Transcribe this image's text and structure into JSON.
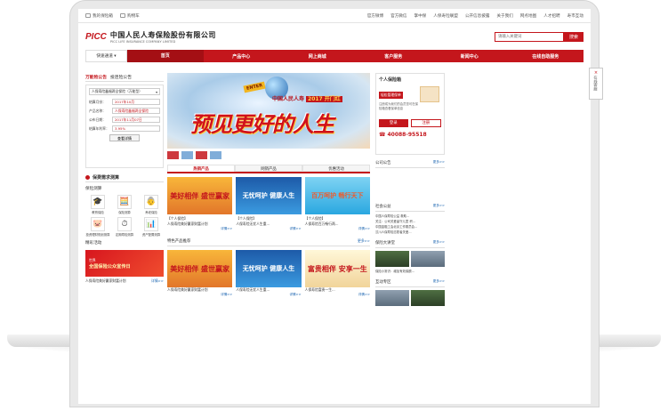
{
  "topbar": {
    "left": [
      "我的保险箱",
      "购物车"
    ],
    "right": [
      "官方微博",
      "官方微信",
      "掌中保",
      "人保寿险联盟",
      "公开信息披露",
      "关于我们",
      "网点地图",
      "人才招聘",
      "寿市互动"
    ]
  },
  "header": {
    "logo_mark": "PICC",
    "company_cn": "中国人民人寿保险股份有限公司",
    "company_en": "PICC LIFE INSURANCE COMPANY LIMITED",
    "search_placeholder": "请输入关键词",
    "search_button": "搜索"
  },
  "nav": {
    "quick": "快速通道",
    "items": [
      "首页",
      "产品中心",
      "网上商城",
      "客户服务",
      "新闻中心",
      "在线自助服务"
    ]
  },
  "left": {
    "tabs": [
      "万能险公告",
      "投连险公告"
    ],
    "product_select": "人保寿险鑫福两全保险（万能型）",
    "fields": [
      {
        "label": "结算月份：",
        "value": "2017年10月"
      },
      {
        "label": "产品名称：",
        "value": "人保寿险鑫福两全保险"
      },
      {
        "label": "公布日期：",
        "value": "2017年11月07日"
      },
      {
        "label": "结算年利率：",
        "value": "3.95%"
      }
    ],
    "history_button": "查看详情",
    "needs_title": "保费需求测算",
    "calc_title": "保险测算",
    "calculators": [
      "教育保险",
      "保险测算",
      "养老保险",
      "投资理财规划测算",
      "定期寿险测算",
      "资产配置测算"
    ],
    "events_title": "精彩活动",
    "promo_line1": "全国保险公众宣传日",
    "promo_line2": "世界",
    "promo_caption": "人保寿险美好赢家财富计划",
    "promo_more": "详情>>"
  },
  "middle": {
    "banner_sub": "中国人民人寿",
    "banner_year": "2017 开门红",
    "banner_main": "预见更好的人生",
    "banner_badge": "ENTER",
    "product_tabs": [
      "热销产品",
      "网销产品",
      "优惠活动"
    ],
    "hot_cards": [
      {
        "img": "美好相伴 盛世赢家",
        "tag": "【个人保险】",
        "name": "人保寿险美好赢家财富计划",
        "more": "详情>>"
      },
      {
        "img": "无忧呵护 健康人生",
        "tag": "【个人保险】",
        "name": "人保寿险无忧人生重...",
        "more": "详情>>"
      },
      {
        "img": "百万呵护 畅行天下",
        "tag": "【个人保险】",
        "name": "人保寿险百万畅行两...",
        "more": "详情>>"
      }
    ],
    "featured_title": "特色产品推荐",
    "featured_more": "更多>>",
    "featured_cards": [
      {
        "img": "美好相伴 盛世赢家",
        "name": "人保寿险美好赢家财富计划",
        "more": "详情>>"
      },
      {
        "img": "无忧呵护 健康人生",
        "name": "人保寿险无忧人生重...",
        "more": "详情>>"
      },
      {
        "img": "富贵相伴 安享一生",
        "name": "人保寿险富贵一生...",
        "more": "详情>>"
      }
    ]
  },
  "right": {
    "acct_title": "个人保险箱",
    "acct_badge": "轻松管理保单",
    "acct_text": "注册成为我们的会员您可在保险箱查看保单信息",
    "login": "登录",
    "register": "注册",
    "hotline": "40088-95518",
    "announce_title": "公司公告",
    "announce_more": "更多>>",
    "community_title": "社会公益",
    "community_more": "更多>>",
    "community_news": [
      "中国人保寿险公益 救助...",
      "关注：公司关爱留守儿童 积...",
      "中国金融工会北京工作委员会...",
      "汶川人保寿险志愿者关爱..."
    ],
    "classroom_title": "保险大讲堂",
    "classroom_more": "更多>>",
    "classroom_news": "保险小常识：增加有效保额...",
    "interactive_title": "互动专区",
    "interactive_more": "更多>>"
  },
  "float_tab": {
    "label": "在线客服",
    "close": "×"
  }
}
